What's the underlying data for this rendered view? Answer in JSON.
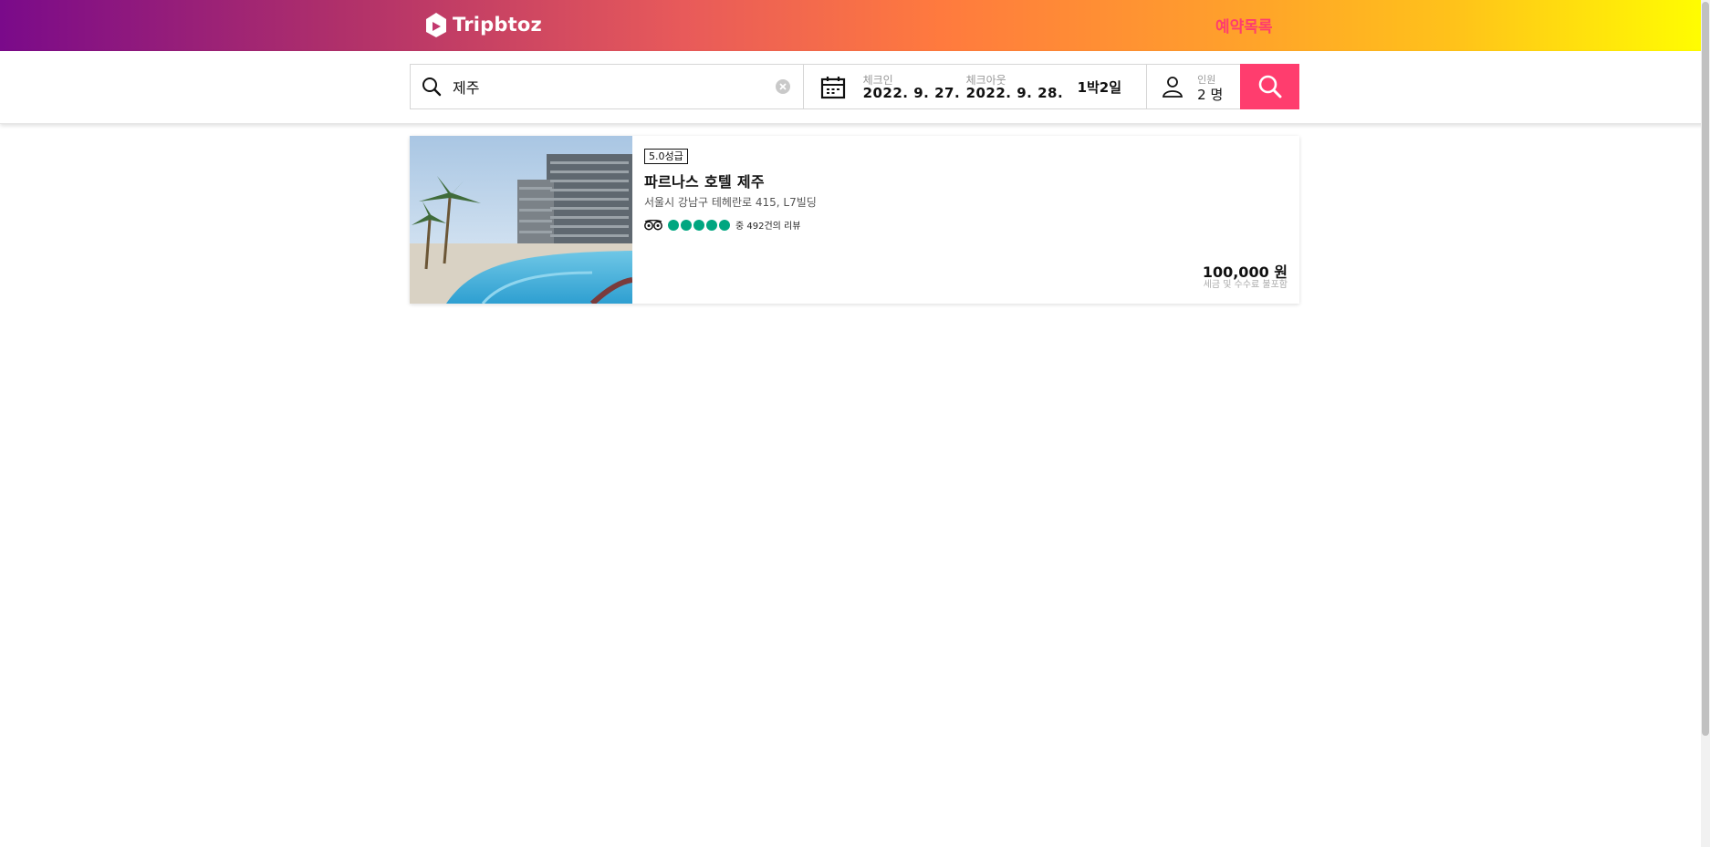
{
  "header": {
    "logo_text": "Tripbtoz",
    "nav_link": "예약목록"
  },
  "search": {
    "destination_value": "제주",
    "checkin_label": "체크인",
    "checkin_value": "2022. 9. 27.",
    "checkout_label": "체크아웃",
    "checkout_value": "2022. 9. 28.",
    "nights": "1박2일",
    "guests_label": "인원",
    "guests_value": "2 명"
  },
  "results": [
    {
      "grade": "5.0성급",
      "name": "파르나스 호텔 제주",
      "address": "서울시 강남구 테헤란로 415, L7빌딩",
      "rating_dots": 5,
      "review_count": "중 492건의 리뷰",
      "price": "100,000 원",
      "tax_note": "세금 및 수수료 불포함"
    }
  ],
  "icons": {
    "logo": "house-play-logo",
    "destination": "search-icon",
    "clear": "clear-circle-icon",
    "date": "calendar-icon",
    "guests": "person-icon",
    "submit": "search-icon",
    "review_source": "tripadvisor-owl-icon"
  },
  "colors": {
    "accent": "#ff3d6e",
    "rating_green": "#00a680",
    "gradient": [
      "#7a0a8a",
      "#ff7a3e",
      "#ffff00"
    ]
  }
}
